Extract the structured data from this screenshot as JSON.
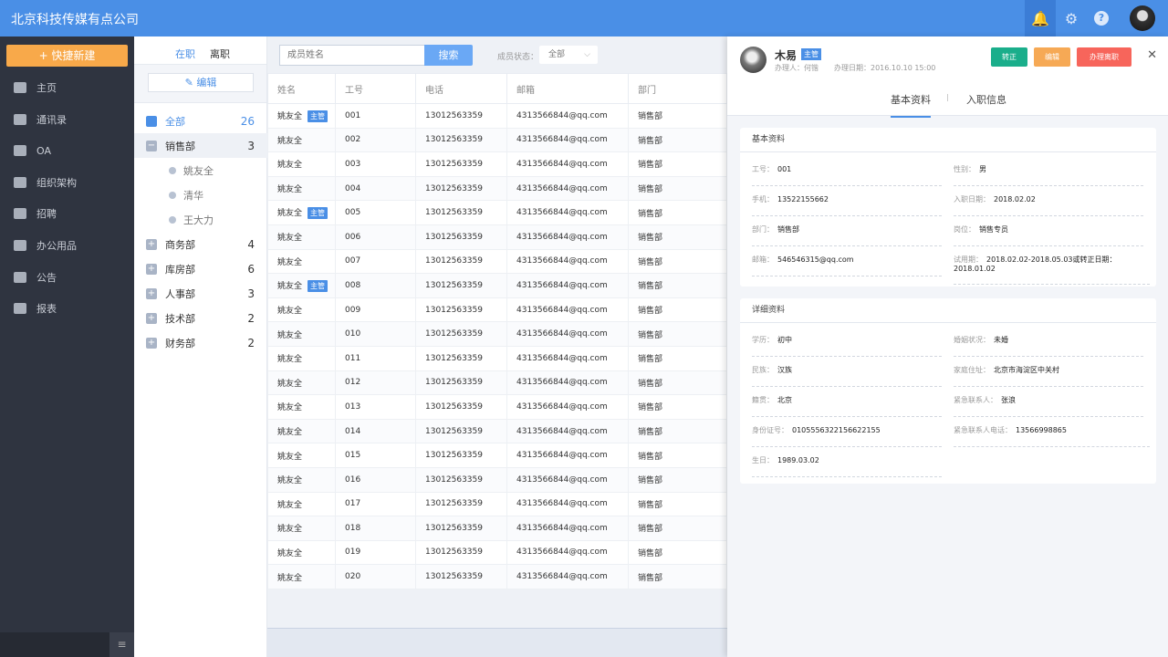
{
  "app": {
    "title": "北京科技传媒有点公司"
  },
  "topbar": {
    "icons": [
      "bell-icon",
      "gear-icon",
      "help-icon",
      "user-avatar"
    ]
  },
  "sidebar": {
    "quick_create": "+ 快捷新建",
    "items": [
      {
        "label": "主页",
        "icon": "home-icon"
      },
      {
        "label": "通讯录",
        "icon": "contacts-icon"
      },
      {
        "label": "OA",
        "icon": "oa-icon"
      },
      {
        "label": "组织架构",
        "icon": "org-icon"
      },
      {
        "label": "招聘",
        "icon": "recruit-icon"
      },
      {
        "label": "办公用品",
        "icon": "printer-icon"
      },
      {
        "label": "公告",
        "icon": "megaphone-icon"
      },
      {
        "label": "报表",
        "icon": "pie-chart-icon"
      }
    ],
    "collapse_icon": "≡"
  },
  "dept": {
    "tabs": [
      "在职",
      "离职"
    ],
    "edit_label": "编辑",
    "all": {
      "label": "全部",
      "count": "26"
    },
    "groups": [
      {
        "label": "销售部",
        "count": "3",
        "expanded": true,
        "members": [
          "姚友全",
          "清华",
          "王大力"
        ]
      },
      {
        "label": "商务部",
        "count": "4"
      },
      {
        "label": "库房部",
        "count": "6"
      },
      {
        "label": "人事部",
        "count": "3"
      },
      {
        "label": "技术部",
        "count": "2"
      },
      {
        "label": "财务部",
        "count": "2"
      }
    ]
  },
  "toolbar": {
    "search_placeholder": "成员姓名",
    "search_button": "搜索",
    "status_label": "成员状态：",
    "status_value": "全部"
  },
  "table": {
    "headers": [
      "姓名",
      "工号",
      "电话",
      "邮箱",
      "部门"
    ],
    "badge": "主管",
    "rows": [
      {
        "name": "姚友全",
        "id": "001",
        "phone": "13012563359",
        "email": "4313566844@qq.com",
        "dept": "销售部",
        "lead": true
      },
      {
        "name": "姚友全",
        "id": "002",
        "phone": "13012563359",
        "email": "4313566844@qq.com",
        "dept": "销售部"
      },
      {
        "name": "姚友全",
        "id": "003",
        "phone": "13012563359",
        "email": "4313566844@qq.com",
        "dept": "销售部"
      },
      {
        "name": "姚友全",
        "id": "004",
        "phone": "13012563359",
        "email": "4313566844@qq.com",
        "dept": "销售部"
      },
      {
        "name": "姚友全",
        "id": "005",
        "phone": "13012563359",
        "email": "4313566844@qq.com",
        "dept": "销售部",
        "lead": true
      },
      {
        "name": "姚友全",
        "id": "006",
        "phone": "13012563359",
        "email": "4313566844@qq.com",
        "dept": "销售部"
      },
      {
        "name": "姚友全",
        "id": "007",
        "phone": "13012563359",
        "email": "4313566844@qq.com",
        "dept": "销售部"
      },
      {
        "name": "姚友全",
        "id": "008",
        "phone": "13012563359",
        "email": "4313566844@qq.com",
        "dept": "销售部",
        "lead": true
      },
      {
        "name": "姚友全",
        "id": "009",
        "phone": "13012563359",
        "email": "4313566844@qq.com",
        "dept": "销售部"
      },
      {
        "name": "姚友全",
        "id": "010",
        "phone": "13012563359",
        "email": "4313566844@qq.com",
        "dept": "销售部"
      },
      {
        "name": "姚友全",
        "id": "011",
        "phone": "13012563359",
        "email": "4313566844@qq.com",
        "dept": "销售部"
      },
      {
        "name": "姚友全",
        "id": "012",
        "phone": "13012563359",
        "email": "4313566844@qq.com",
        "dept": "销售部"
      },
      {
        "name": "姚友全",
        "id": "013",
        "phone": "13012563359",
        "email": "4313566844@qq.com",
        "dept": "销售部"
      },
      {
        "name": "姚友全",
        "id": "014",
        "phone": "13012563359",
        "email": "4313566844@qq.com",
        "dept": "销售部"
      },
      {
        "name": "姚友全",
        "id": "015",
        "phone": "13012563359",
        "email": "4313566844@qq.com",
        "dept": "销售部"
      },
      {
        "name": "姚友全",
        "id": "016",
        "phone": "13012563359",
        "email": "4313566844@qq.com",
        "dept": "销售部"
      },
      {
        "name": "姚友全",
        "id": "017",
        "phone": "13012563359",
        "email": "4313566844@qq.com",
        "dept": "销售部"
      },
      {
        "name": "姚友全",
        "id": "018",
        "phone": "13012563359",
        "email": "4313566844@qq.com",
        "dept": "销售部"
      },
      {
        "name": "姚友全",
        "id": "019",
        "phone": "13012563359",
        "email": "4313566844@qq.com",
        "dept": "销售部"
      },
      {
        "name": "姚友全",
        "id": "020",
        "phone": "13012563359",
        "email": "4313566844@qq.com",
        "dept": "销售部"
      }
    ]
  },
  "detail": {
    "name": "木易",
    "badge": "主管",
    "handler": "办理人：何锴",
    "date": "办理日期：2016.10.10  15:00",
    "buttons": [
      {
        "label": "转正",
        "color": "#1aae8b"
      },
      {
        "label": "编辑",
        "color": "#f6a955"
      },
      {
        "label": "办理离职",
        "color": "#f7655b"
      }
    ],
    "tabs": [
      "基本资料",
      "入职信息"
    ],
    "basic": {
      "title": "基本资料",
      "fields": [
        {
          "k": "工号：",
          "v": "001"
        },
        {
          "k": "性别：",
          "v": "男"
        },
        {
          "k": "手机：",
          "v": "13522155662"
        },
        {
          "k": "入职日期：",
          "v": "2018.02.02"
        },
        {
          "k": "部门：",
          "v": "销售部"
        },
        {
          "k": "岗位：",
          "v": "销售专员"
        },
        {
          "k": "邮箱：",
          "v": "546546315@qq.com"
        },
        {
          "k": "试用期：",
          "v": "2018.02.02-2018.05.03或转正日期：2018.01.02"
        }
      ]
    },
    "more": {
      "title": "详细资料",
      "fields": [
        {
          "k": "学历：",
          "v": "初中"
        },
        {
          "k": "婚姻状况：",
          "v": "未婚"
        },
        {
          "k": "民族：",
          "v": "汉族"
        },
        {
          "k": "家庭住址：",
          "v": "北京市海淀区中关村"
        },
        {
          "k": "籍贯：",
          "v": "北京"
        },
        {
          "k": "紧急联系人：",
          "v": "张浪"
        },
        {
          "k": "身份证号：",
          "v": "0105556322156622155"
        },
        {
          "k": "紧急联系人电话：",
          "v": "13566998865"
        },
        {
          "k": "生日：",
          "v": "1989.03.02"
        }
      ]
    }
  }
}
